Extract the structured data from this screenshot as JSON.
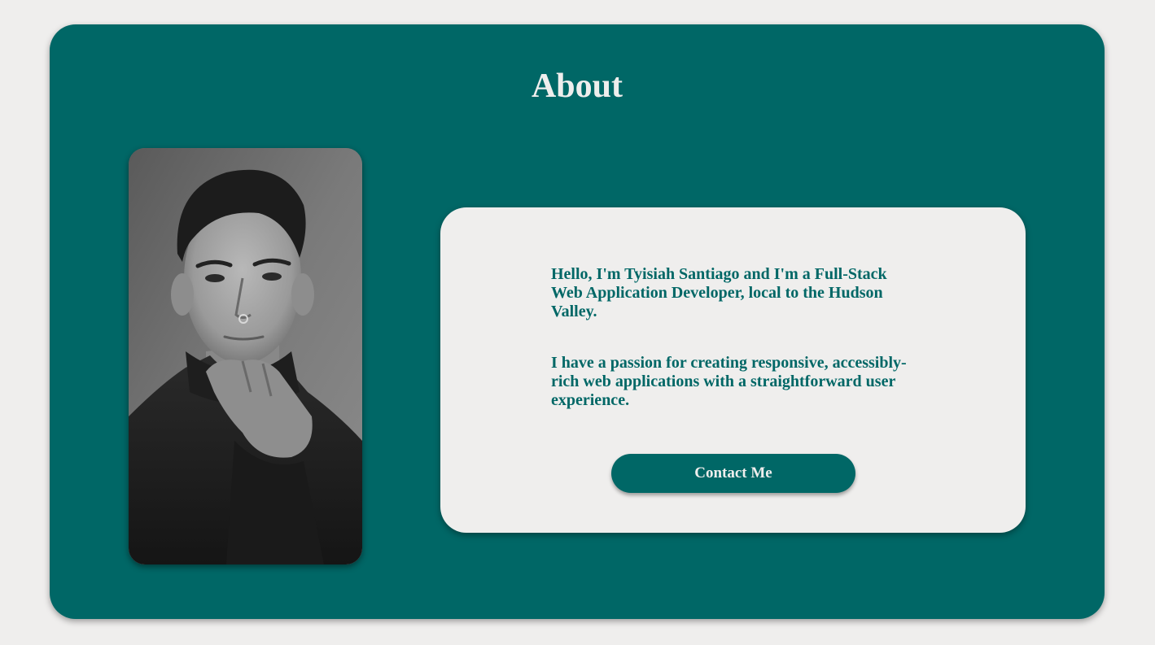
{
  "about": {
    "title": "About",
    "portrait": {
      "alt": "Portrait of Tyisiah Santiago"
    },
    "bio": {
      "paragraph_1": "Hello, I'm Tyisiah Santiago and I'm a Full-Stack Web Application Developer, local to the Hudson Valley.",
      "paragraph_2": "I have a passion for creating responsive, accessibly-rich web applications with a straightforward user experience."
    },
    "contact_button_label": "Contact Me"
  },
  "colors": {
    "page_background": "#efeeed",
    "accent": "#006766",
    "card_background": "#efeeed"
  }
}
